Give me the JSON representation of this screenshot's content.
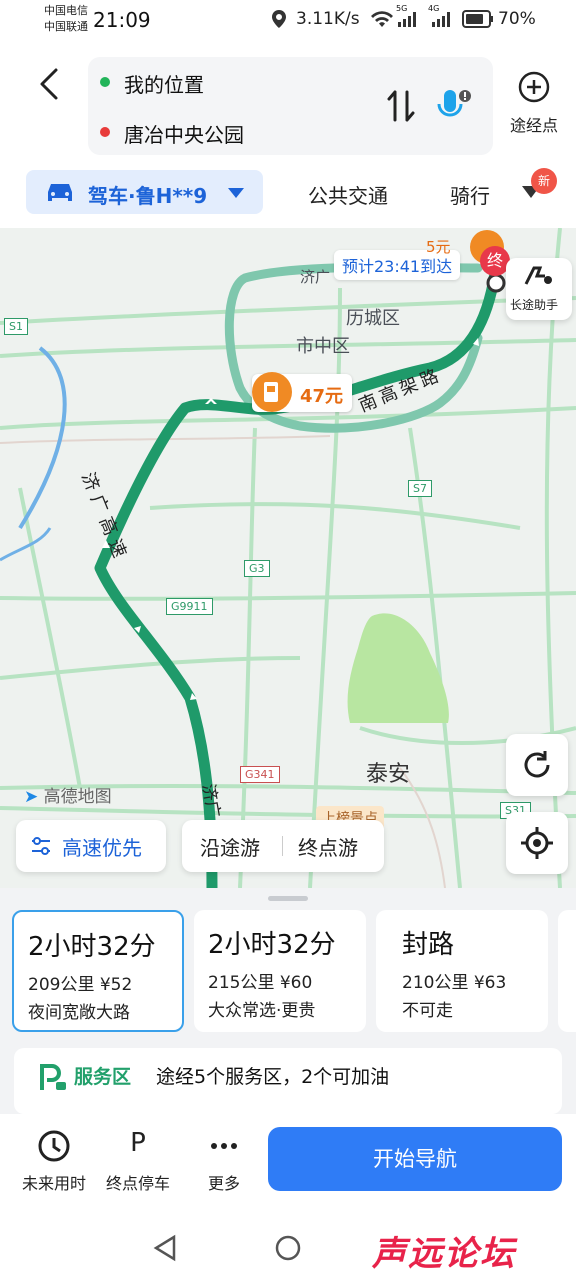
{
  "status_bar": {
    "carrier1": "中国电信",
    "carrier2": "中国联通",
    "time": "21:09",
    "network_speed": "3.11K/s",
    "signal1": "5G",
    "signal2": "4G",
    "battery": "70%"
  },
  "header": {
    "origin": "我的位置",
    "destination": "唐冶中央公园",
    "waypoint_label": "途经点"
  },
  "tabs": {
    "drive": "驾车·鲁H**9",
    "transit": "公共交通",
    "ride": "骑行",
    "new_badge": "新"
  },
  "map": {
    "eta": "预计23:41到达",
    "toll_top": "5元",
    "toll_main": "47元",
    "end_marker": "终",
    "long_trip_helper": "长途助手",
    "districts": [
      "历城区",
      "市中区",
      "泰安"
    ],
    "road_labels": [
      "济广高速",
      "南高架路",
      "济广",
      "济广"
    ],
    "road_shields": [
      "S1",
      "S7",
      "G3",
      "G9911",
      "G341",
      "S31"
    ],
    "logo": "高德地图",
    "scenic_tag": "上榜景点",
    "highway_pref": "高速优先",
    "along_trip": "沿途游",
    "end_trip": "终点游",
    "colors": {
      "route": "#1f9a6a",
      "route_alt": "#7fc7ad",
      "greenspace": "#b8e6a1"
    }
  },
  "route_options": [
    {
      "time": "2小时32分",
      "distance": "209公里",
      "price": "¥52",
      "tag": "夜间宽敞大路",
      "selected": true
    },
    {
      "time": "2小时32分",
      "distance": "215公里",
      "price": "¥60",
      "tag": "大众常选·更贵",
      "selected": false
    },
    {
      "time": "封路",
      "distance": "210公里",
      "price": "¥63",
      "tag": "不可走",
      "selected": false
    }
  ],
  "service_area": {
    "label": "服务区",
    "text": "途经5个服务区，2个可加油"
  },
  "actions": {
    "future": "未来用时",
    "parking": "终点停车",
    "more": "更多",
    "parking_icon": "P",
    "start": "开始导航"
  },
  "watermark": "声远论坛"
}
